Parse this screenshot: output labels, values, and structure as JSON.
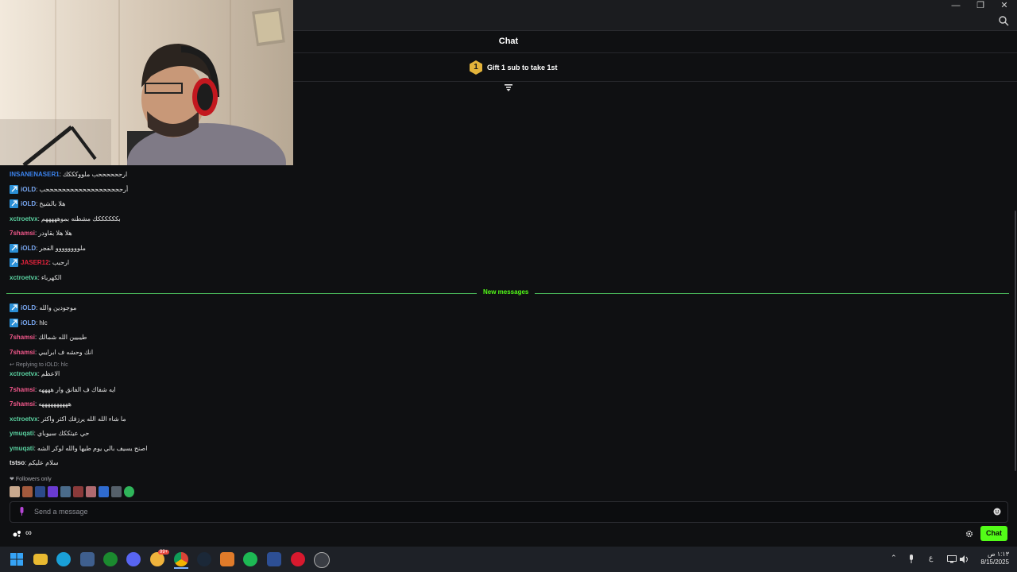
{
  "window": {
    "controls": {
      "minimize": "—",
      "restore": "❐",
      "close": "✕"
    }
  },
  "chat": {
    "title": "Chat",
    "gift_rank": "1",
    "gift_text": "Gift 1 sub to take 1st"
  },
  "messages_before": [
    {
      "user": "INSANENASER1",
      "color": "#3c84f0",
      "mod": false,
      "text": "ارححححححب ملووكككك"
    },
    {
      "user": "iOLD",
      "color": "#79a8f2",
      "mod": true,
      "text": "أرحححححححححححححححححححب"
    },
    {
      "user": "iOLD",
      "color": "#79a8f2",
      "mod": true,
      "text": "هلا بالشيخ"
    },
    {
      "user": "xctroetvx",
      "color": "#5ad2a1",
      "mod": false,
      "text": "بككككككك مشطنه بموهههههم"
    },
    {
      "user": "7shamsi",
      "color": "#f1588b",
      "mod": false,
      "text": "هلا هلا بقاودر"
    },
    {
      "user": "iOLD",
      "color": "#79a8f2",
      "mod": true,
      "text": "ملوووووووو الفجر"
    },
    {
      "user": "JASER12",
      "color": "#e5233c",
      "mod": true,
      "text": "ارحبب"
    },
    {
      "user": "xctroetvx",
      "color": "#5ad2a1",
      "mod": false,
      "text": "الكهرباء"
    }
  ],
  "new_messages_label": "New messages",
  "messages_after": [
    {
      "user": "iOLD",
      "color": "#79a8f2",
      "mod": true,
      "text": "موجودين والله"
    },
    {
      "user": "iOLD",
      "color": "#79a8f2",
      "mod": true,
      "text": "hlc"
    },
    {
      "user": "7shamsi",
      "color": "#f1588b",
      "mod": false,
      "text": "طيبيين الله شمالك"
    },
    {
      "user": "7shamsi",
      "color": "#f1588b",
      "mod": false,
      "text": "انك وحشه ف ابرايبي"
    },
    {
      "user": "xctroetvx",
      "color": "#5ad2a1",
      "mod": false,
      "text": "الاعظم"
    },
    {
      "user": "7shamsi",
      "color": "#f1588b",
      "mod": false,
      "text": "ايه شفاك ف الفانق وار ههههه"
    },
    {
      "user": "7shamsi",
      "color": "#f1588b",
      "mod": false,
      "text": "ههههههههههه"
    },
    {
      "user": "xctroetvx",
      "color": "#5ad2a1",
      "mod": false,
      "text": "ما شاء الله الله يرزقك اكثر واكثر"
    },
    {
      "user": "ymuqati",
      "color": "#5ad2a1",
      "mod": false,
      "text": "حي عيتككك سيوباي"
    },
    {
      "user": "ymuqati",
      "color": "#5ad2a1",
      "mod": false,
      "text": "اصنح يسيف بالي يوم طيها والله لوكر الشه"
    },
    {
      "user": "tstso",
      "color": "#e9e9ea",
      "mod": false,
      "text": "سلام عليكم"
    }
  ],
  "reply_text": "Replying to iOLD: hlc",
  "followers_only": "Followers only",
  "input": {
    "placeholder": "Send a message"
  },
  "points": "∞",
  "chat_button": "Chat",
  "tray": {
    "lang": "ع"
  },
  "clock": {
    "time": "١:١٣ ص",
    "date": "8/15/2025"
  },
  "taskbar_badge": "99+",
  "colors": {
    "accent": "#53fc18",
    "background": "#0f1012"
  }
}
